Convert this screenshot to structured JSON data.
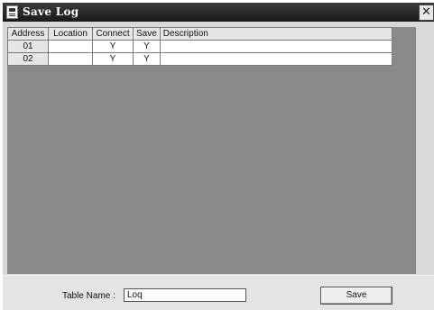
{
  "window": {
    "title": "Save Log",
    "close_glyph": "✕"
  },
  "table": {
    "columns": [
      "Address",
      "Location",
      "Connect",
      "Save",
      "Description"
    ],
    "rows": [
      {
        "address": "01",
        "location": "",
        "connect": "Y",
        "save": "Y",
        "description": ""
      },
      {
        "address": "02",
        "location": "",
        "connect": "Y",
        "save": "Y",
        "description": ""
      }
    ]
  },
  "footer": {
    "table_name_label": "Table Name :",
    "table_name_value": "Loq",
    "save_label": "Save"
  }
}
